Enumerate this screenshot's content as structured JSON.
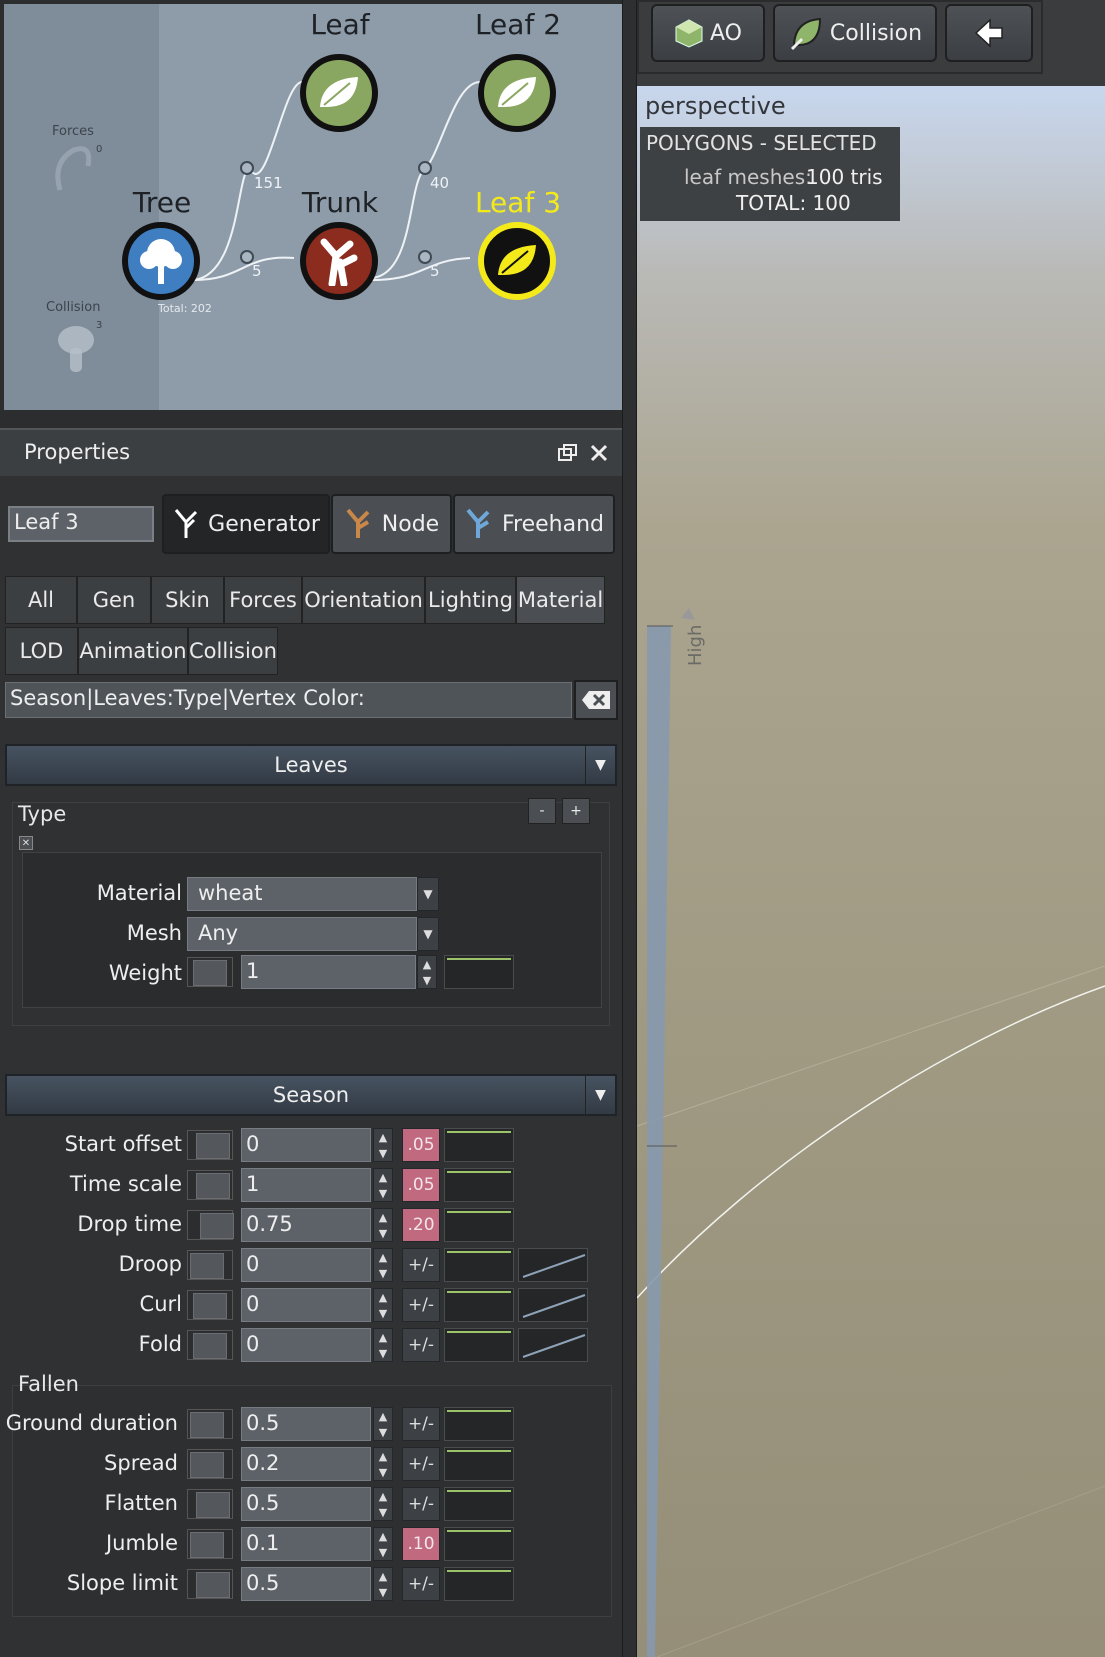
{
  "graph": {
    "side_forces": {
      "label": "Forces",
      "count": "0"
    },
    "side_collision": {
      "label": "Collision",
      "count": "3"
    },
    "nodes": {
      "tree": "Tree",
      "trunk": "Trunk",
      "leaf": "Leaf",
      "leaf2": "Leaf 2",
      "leaf3": "Leaf 3"
    },
    "counts": {
      "tree_leaf": "151",
      "tree_trunk": "5",
      "trunk_leaf2": "40",
      "trunk_leaf3": "5"
    },
    "total": "Total: 202"
  },
  "toolbar": {
    "ao": "AO",
    "collision": "Collision"
  },
  "viewport": {
    "title": "perspective",
    "stats_header": "POLYGONS - SELECTED",
    "stats_leaf_label": "leaf meshes:",
    "stats_leaf_value": "100 tris",
    "stats_total": "TOTAL: 100",
    "height_label": "High"
  },
  "properties": {
    "title": "Properties",
    "node_name": "Leaf 3",
    "modes": {
      "generator": "Generator",
      "node": "Node",
      "freehand": "Freehand"
    },
    "tabs_row1": [
      "All",
      "Gen",
      "Skin",
      "Forces",
      "Orientation",
      "Lighting",
      "Material"
    ],
    "tabs_row2": [
      "LOD",
      "Animation",
      "Collision"
    ],
    "filter": "Season|Leaves:Type|Vertex Color:",
    "leaves": {
      "header": "Leaves",
      "type_label": "Type",
      "minus": "-",
      "plus": "+",
      "material_label": "Material",
      "material_value": "wheat",
      "mesh_label": "Mesh",
      "mesh_value": "Any",
      "weight_label": "Weight",
      "weight_value": "1"
    },
    "season": {
      "header": "Season",
      "rows": [
        {
          "label": "Start offset",
          "value": "0",
          "var": ".05"
        },
        {
          "label": "Time scale",
          "value": "1",
          "var": ".05"
        },
        {
          "label": "Drop time",
          "value": "0.75",
          "var": ".20"
        },
        {
          "label": "Droop",
          "value": "0",
          "var": "+/-"
        },
        {
          "label": "Curl",
          "value": "0",
          "var": "+/-"
        },
        {
          "label": "Fold",
          "value": "0",
          "var": "+/-"
        }
      ],
      "fallen_label": "Fallen",
      "fallen_rows": [
        {
          "label": "Ground duration",
          "value": "0.5",
          "var": "+/-"
        },
        {
          "label": "Spread",
          "value": "0.2",
          "var": "+/-"
        },
        {
          "label": "Flatten",
          "value": "0.5",
          "var": "+/-"
        },
        {
          "label": "Jumble",
          "value": "0.1",
          "var": ".10"
        },
        {
          "label": "Slope limit",
          "value": "0.5",
          "var": "+/-"
        }
      ]
    }
  },
  "colors": {
    "selected_node": "#f4ea1a",
    "pink_variance": "#c1697f"
  }
}
